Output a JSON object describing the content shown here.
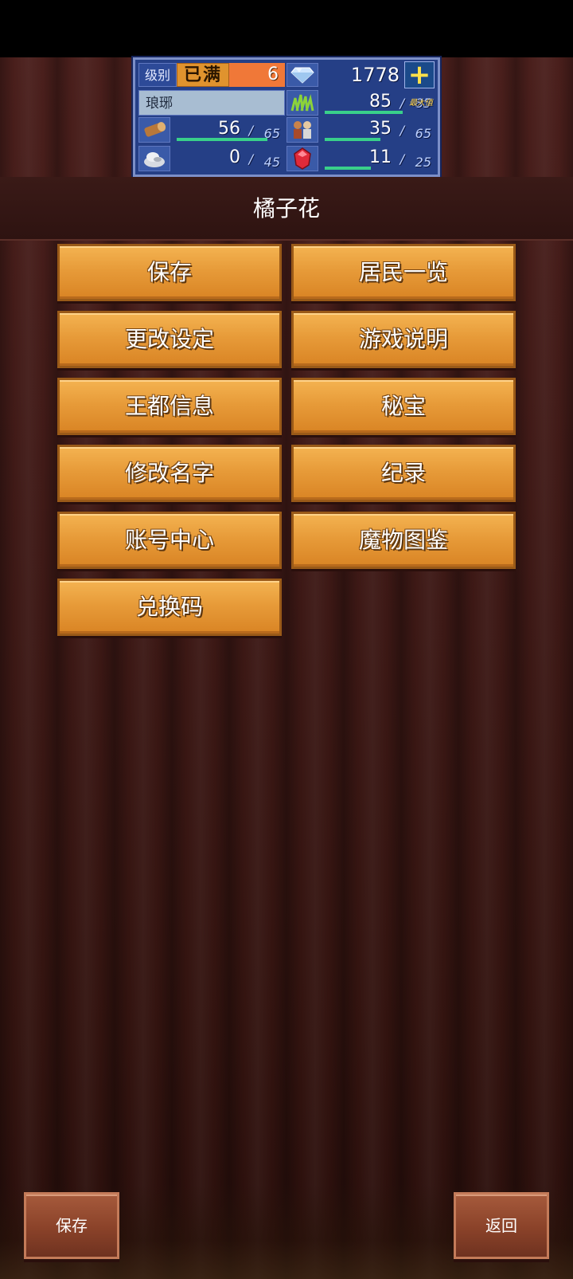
{
  "status": {
    "level_label": "级别",
    "level_max_badge": "已满",
    "level_value": "6",
    "gems": "1778",
    "plus": "+",
    "kingdom_name": "琅琊",
    "resources": [
      {
        "icon": "wood-log-icon",
        "current": "56",
        "max": "65",
        "ratio": 0.86
      },
      {
        "icon": "stone-ore-icon",
        "current": "0",
        "max": "45",
        "ratio": 0.0
      },
      {
        "icon": "grass-food-icon",
        "current": "85",
        "max": "85",
        "ratio": 1.0,
        "max_tag": "最大值"
      },
      {
        "icon": "villagers-icon",
        "current": "35",
        "max": "65",
        "ratio": 0.54
      },
      {
        "icon": "red-gem-icon",
        "current": "11",
        "max": "25",
        "ratio": 0.44
      }
    ],
    "slash": "/"
  },
  "title": "橘子花",
  "menu": {
    "save": "保存",
    "residents": "居民一览",
    "settings": "更改设定",
    "instructions": "游戏说明",
    "capital_info": "王都信息",
    "treasure": "秘宝",
    "rename": "修改名字",
    "records": "纪录",
    "account": "账号中心",
    "monster_book": "魔物图鉴",
    "redeem": "兑换码"
  },
  "bottom": {
    "save": "保存",
    "back": "返回"
  },
  "colors": {
    "button_orange": "#e79b39",
    "panel_blue": "#253f86",
    "curtain": "#3e1916"
  }
}
